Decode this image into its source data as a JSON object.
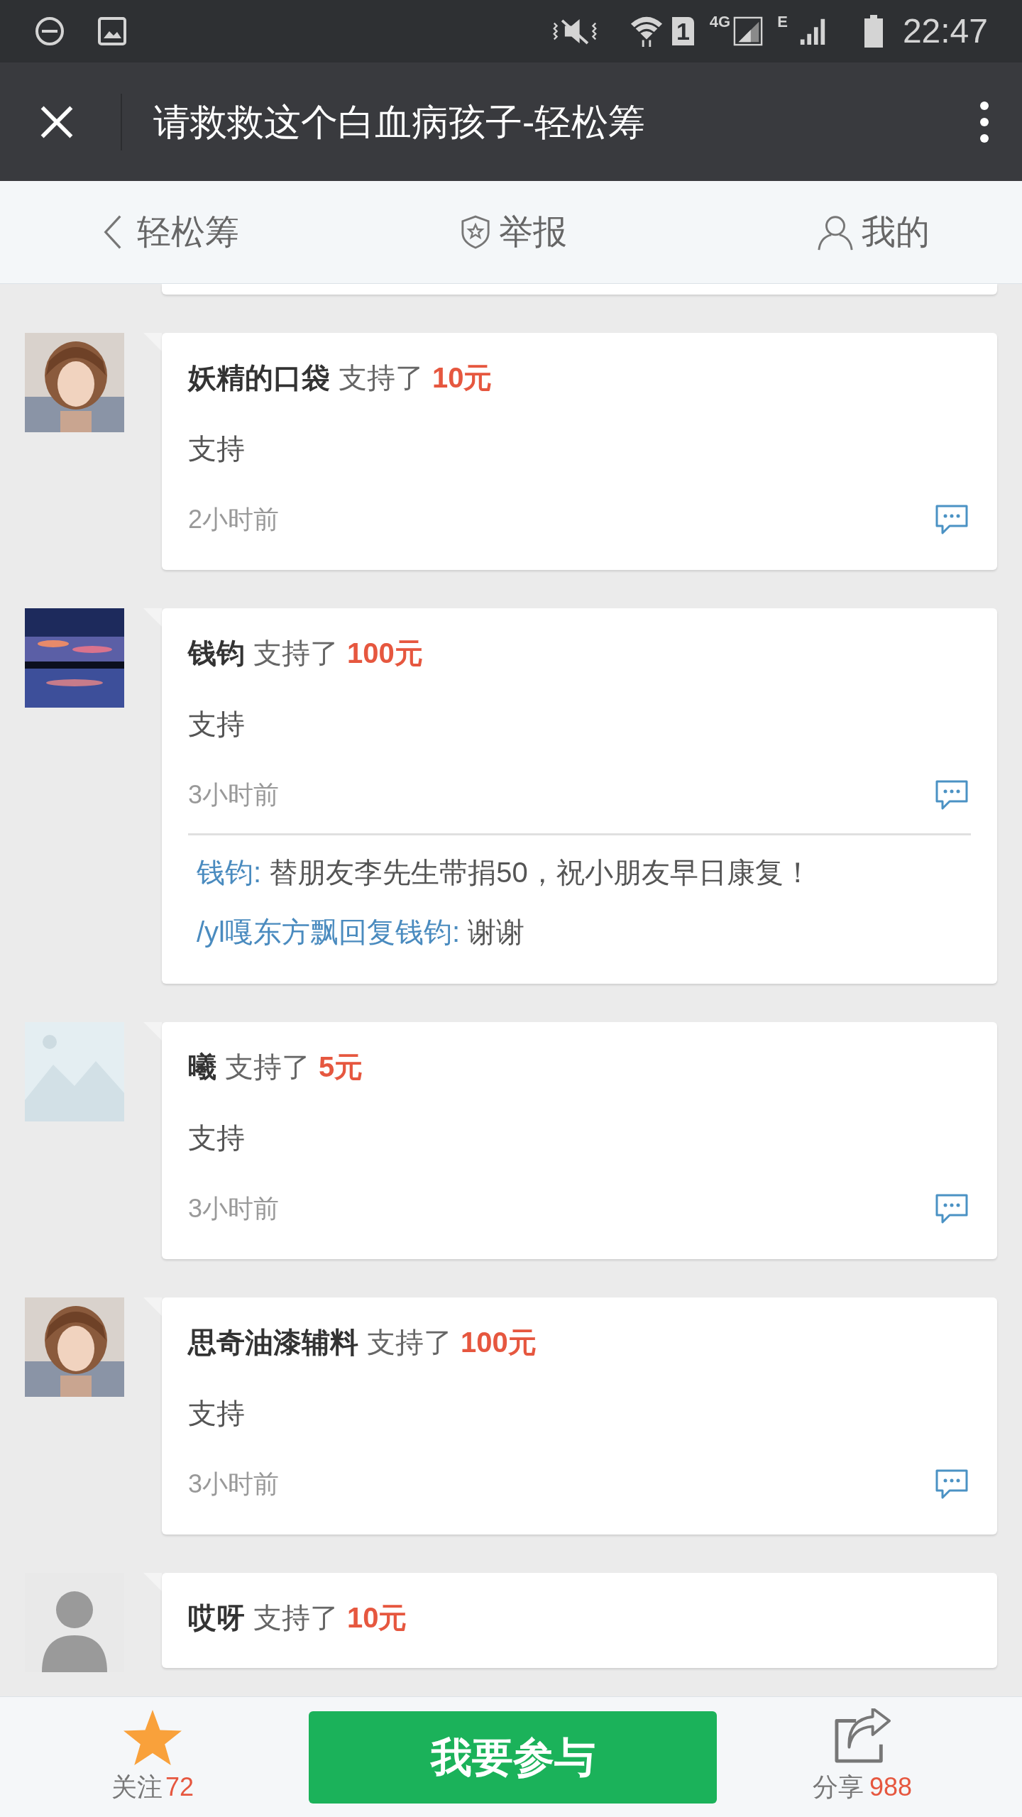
{
  "status_bar": {
    "sim_slot": "1",
    "network": "4G",
    "network_2": "E",
    "time": "22:47"
  },
  "header": {
    "title": "请救救这个白血病孩子-轻松筹"
  },
  "nav": {
    "back": "轻松筹",
    "report": "举报",
    "mine": "我的"
  },
  "donations": [
    {
      "name": "妖精的口袋",
      "action": "支持了",
      "amount": "10元",
      "message": "支持",
      "time": "2小时前"
    },
    {
      "name": "钱钧",
      "action": "支持了",
      "amount": "100元",
      "message": "支持",
      "time": "3小时前",
      "replies": [
        {
          "author": "钱钧:",
          "text": "替朋友李先生带捐50，祝小朋友早日康复！"
        },
        {
          "author": "/yl嘎东方飘回复钱钧:",
          "text": "谢谢"
        }
      ]
    },
    {
      "avatar": {
        "kind": "placeholder"
      },
      "name": "曦",
      "action": "支持了",
      "amount": "5元",
      "message": "支持",
      "time": "3小时前"
    },
    {
      "name": "思奇油漆辅料",
      "action": "支持了",
      "amount": "100元",
      "message": "支持",
      "time": "3小时前"
    },
    {
      "avatar": {
        "kind": "silhouette"
      },
      "name": "哎呀",
      "action": "支持了",
      "amount": "10元"
    }
  ],
  "bottom_bar": {
    "follow_label": "关注",
    "follow_count": "72",
    "join_button": "我要参与",
    "share_label": "分享",
    "share_count": "988"
  }
}
